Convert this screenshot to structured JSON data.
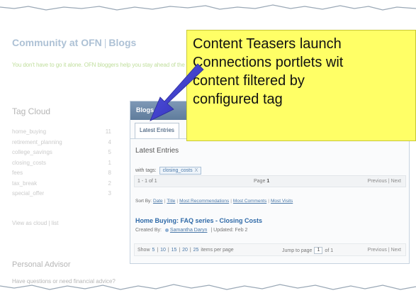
{
  "community": {
    "title_part1": "Community at OFN",
    "separator": "|",
    "title_part2": "Blogs",
    "tagline": "You don't have to go it alone. OFN bloggers help you stay ahead of the cu"
  },
  "tag_cloud": {
    "title": "Tag Cloud",
    "tags": [
      {
        "name": "home_buying",
        "count": "11"
      },
      {
        "name": "retirement_planning",
        "count": "4"
      },
      {
        "name": "college_savings",
        "count": "5"
      },
      {
        "name": "closing_costs",
        "count": "1"
      },
      {
        "name": "fees",
        "count": "8"
      },
      {
        "name": "tax_break",
        "count": "2"
      },
      {
        "name": "special_offer",
        "count": "3"
      }
    ],
    "view_as": "View as cloud | list"
  },
  "advisor": {
    "title": "Personal Advisor",
    "text": "Have questions or need financial advice?"
  },
  "blogs_portlet": {
    "title": "Blogs",
    "tab_label": "Latest Entries",
    "section_heading": "Latest Entries",
    "with_tags_label": "with tags:",
    "tag_filter": "closing_costs",
    "tag_remove": "X",
    "range_text": "1 - 1 of 1",
    "page_label": "Page",
    "page_number": "1",
    "nav_text": "Previous | Next",
    "sort_by_label": "Sort By:",
    "sort_options": [
      "Date",
      "Title",
      "Most Recommendations",
      "Most Comments",
      "Most Visits"
    ],
    "entry_title": "Home Buying: FAQ series - Closing Costs",
    "created_by_label": "Created By:",
    "author": "Samantha Daryn",
    "updated_text": "| Updated: Feb 2",
    "show_label": "Show",
    "show_options": [
      "5",
      "10",
      "15",
      "20",
      "25"
    ],
    "items_per_page": "items per page",
    "jump_label": "Jump to page",
    "jump_value": "1",
    "jump_of": "of 1",
    "pager_nav": "Previous | Next"
  },
  "callout": {
    "text": "Content Teasers launch\nConnections portlets wit\ncontent filtered by\nconfigured tag",
    "color": "#ffff66"
  },
  "arrow_color": "#3d3dd6"
}
